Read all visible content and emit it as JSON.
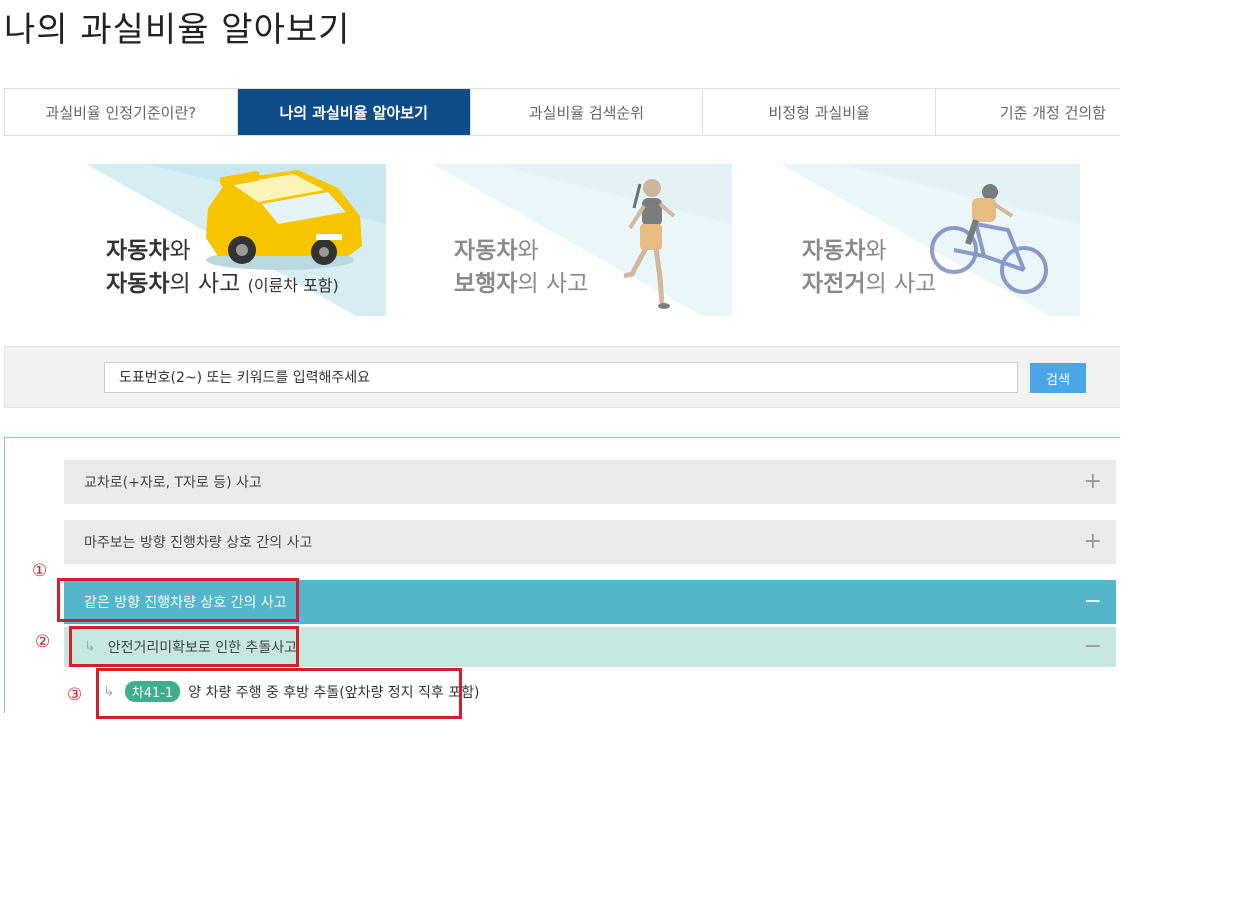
{
  "page_title": "나의 과실비율 알아보기",
  "tabs": [
    {
      "label": "과실비율 인정기준이란?",
      "active": false
    },
    {
      "label": "나의 과실비율 알아보기",
      "active": true
    },
    {
      "label": "과실비율 검색순위",
      "active": false
    },
    {
      "label": "비정형 과실비율",
      "active": false
    },
    {
      "label": "기준 개정 건의함",
      "active": false
    }
  ],
  "cards": [
    {
      "line1_bold": "자동차",
      "line1_rest": "와",
      "line2_bold": "자동차",
      "line2_rest": "의 사고 ",
      "line2_small": "(이륜차 포함)",
      "image": "car-icon"
    },
    {
      "line1_bold": "자동차",
      "line1_rest": "와",
      "line2_bold": "보행자",
      "line2_rest": "의 사고",
      "image": "pedestrian-icon"
    },
    {
      "line1_bold": "자동차",
      "line1_rest": "와",
      "line2_bold": "자전거",
      "line2_rest": "의 사고",
      "image": "bicycle-icon"
    }
  ],
  "search": {
    "placeholder": "도표번호(2~) 또는 키워드를 입력해주세요",
    "button_label": "검색"
  },
  "accordion": {
    "items": [
      {
        "label": "교차로(+자로, T자로 등) 사고",
        "toggle": "+"
      },
      {
        "label": "마주보는 방향 진행차량 상호 간의 사고",
        "toggle": "+"
      },
      {
        "label": "같은 방향 진행차량 상호 간의 사고",
        "toggle": "−"
      }
    ],
    "sub": {
      "arrow": "↳",
      "label": "안전거리미확보로 인한 추돌사고",
      "toggle": "−"
    },
    "leaf": {
      "arrow": "↳",
      "badge": "차41-1",
      "label": "양 차량 주행 중 후방 추돌(앞차량 정지 직후 포함)"
    }
  },
  "annotations": [
    "①",
    "②",
    "③"
  ],
  "colors": {
    "active_tab": "#0f4c8a",
    "open_accordion": "#53b6ca",
    "sub_accordion": "#c6e7df",
    "badge": "#3fae8c",
    "search_button": "#4aa6e6",
    "highlight": "#d0202d"
  }
}
